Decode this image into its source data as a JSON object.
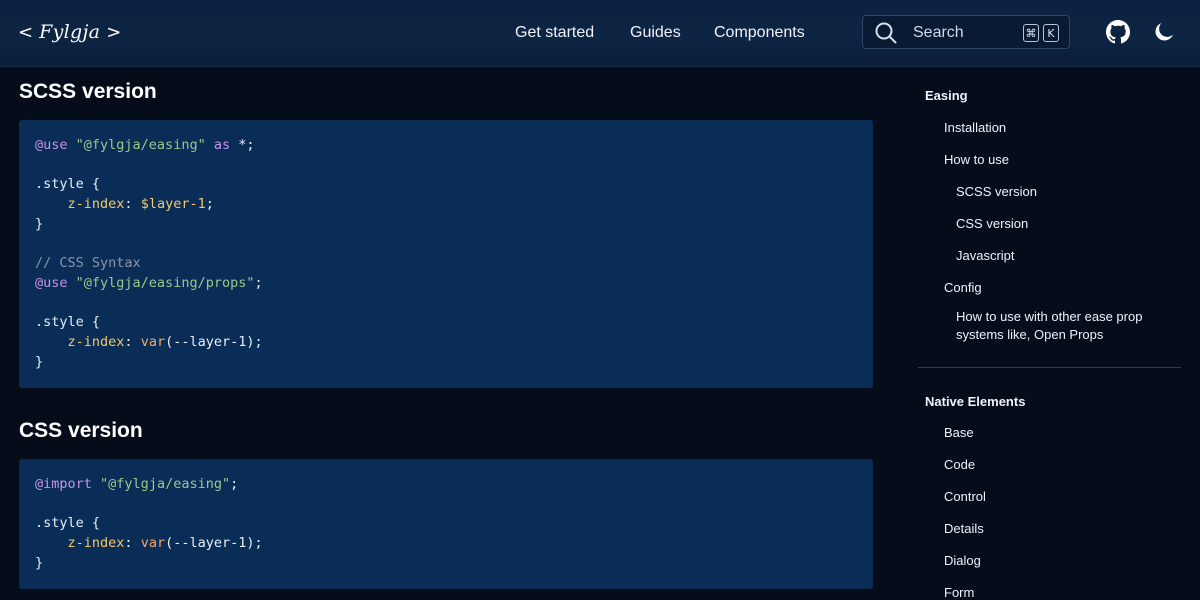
{
  "header": {
    "logo_left": "<",
    "logo_text": "Fylgja",
    "logo_right": ">",
    "nav": [
      "Get started",
      "Guides",
      "Components"
    ],
    "search_placeholder": "Search",
    "search_key_cmd": "⌘",
    "search_key_k": "K"
  },
  "main": {
    "sections": [
      {
        "title": "SCSS version",
        "code": [
          [
            {
              "t": "@use",
              "c": "kw"
            },
            {
              "t": " "
            },
            {
              "t": "\"@fylgja/easing\"",
              "c": "str"
            },
            {
              "t": " "
            },
            {
              "t": "as",
              "c": "kw"
            },
            {
              "t": " *;"
            }
          ],
          [],
          [
            {
              "t": ".style {"
            }
          ],
          [
            {
              "t": "    "
            },
            {
              "t": "z-index",
              "c": "prop"
            },
            {
              "t": ": "
            },
            {
              "t": "$layer-1",
              "c": "var"
            },
            {
              "t": ";"
            }
          ],
          [
            {
              "t": "}"
            }
          ],
          [],
          [
            {
              "t": "// CSS Syntax",
              "c": "cm"
            }
          ],
          [
            {
              "t": "@use",
              "c": "kw"
            },
            {
              "t": " "
            },
            {
              "t": "\"@fylgja/easing/props\"",
              "c": "str"
            },
            {
              "t": ";"
            }
          ],
          [],
          [
            {
              "t": ".style {"
            }
          ],
          [
            {
              "t": "    "
            },
            {
              "t": "z-index",
              "c": "prop"
            },
            {
              "t": ": "
            },
            {
              "t": "var",
              "c": "fn"
            },
            {
              "t": "(--layer-1);"
            }
          ],
          [
            {
              "t": "}"
            }
          ]
        ]
      },
      {
        "title": "CSS version",
        "code": [
          [
            {
              "t": "@import",
              "c": "kw"
            },
            {
              "t": " "
            },
            {
              "t": "\"@fylgja/easing\"",
              "c": "str"
            },
            {
              "t": ";"
            }
          ],
          [],
          [
            {
              "t": ".style {"
            }
          ],
          [
            {
              "t": "    "
            },
            {
              "t": "z-index",
              "c": "prop"
            },
            {
              "t": ": "
            },
            {
              "t": "var",
              "c": "fn"
            },
            {
              "t": "(--layer-1);"
            }
          ],
          [
            {
              "t": "}"
            }
          ]
        ]
      }
    ]
  },
  "toc": {
    "groups": [
      {
        "title": "Easing",
        "items": [
          {
            "label": "Installation",
            "level": 1
          },
          {
            "label": "How to use",
            "level": 1
          },
          {
            "label": "SCSS version",
            "level": 2
          },
          {
            "label": "CSS version",
            "level": 2
          },
          {
            "label": "Javascript",
            "level": 2
          },
          {
            "label": "Config",
            "level": 1
          },
          {
            "label": "How to use with other ease prop systems like, Open Props",
            "level": 2
          }
        ]
      },
      {
        "title": "Native Elements",
        "items": [
          {
            "label": "Base",
            "level": 1
          },
          {
            "label": "Code",
            "level": 1
          },
          {
            "label": "Control",
            "level": 1
          },
          {
            "label": "Details",
            "level": 1
          },
          {
            "label": "Dialog",
            "level": 1
          },
          {
            "label": "Form",
            "level": 1
          }
        ]
      }
    ]
  },
  "colors": {
    "background": "#050d1a",
    "header": "#0c2241",
    "code_block": "#0a2d57",
    "keyword": "#c792ea",
    "string": "#98c98a",
    "property": "#f2c96b",
    "comment": "#8a96a8"
  }
}
